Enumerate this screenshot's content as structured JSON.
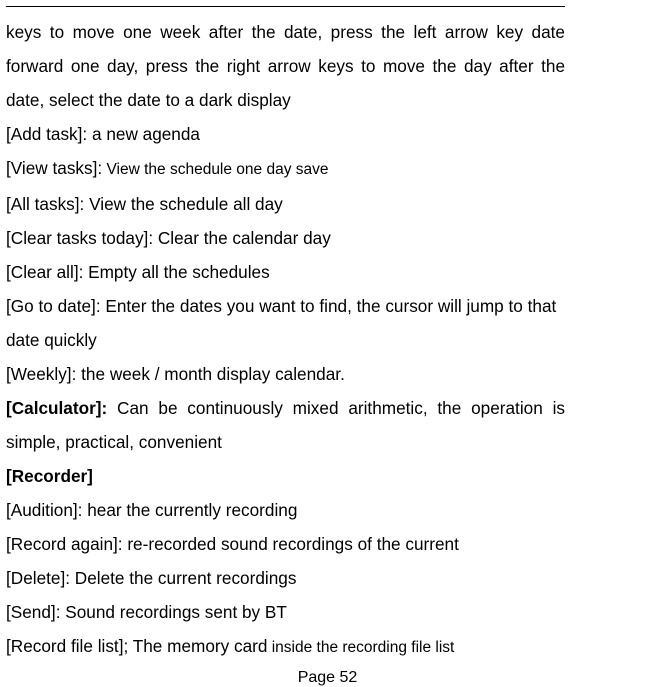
{
  "rule_present": true,
  "intro": "keys to move one week after the date, press the left arrow key date forward one day, press the right arrow keys to move the day after the date, select the date to a dark display",
  "items": [
    {
      "label": "[Add task]:",
      "text": " a new agenda"
    },
    {
      "label": "[View tasks]:",
      "text_small": " View the schedule one day save"
    },
    {
      "label": "[All tasks]:",
      "text": " View the schedule all day"
    },
    {
      "label": "[Clear tasks today]:",
      "text": " Clear the calendar day"
    },
    {
      "label": "[Clear all]:",
      "text": " Empty all the schedules"
    },
    {
      "label": "[Go to date]:",
      "text": " Enter the dates you want to find, the cursor will jump to that date quickly"
    },
    {
      "label": "[Weekly]:",
      "text": " the week / month display calendar."
    }
  ],
  "calculator": {
    "label": "[Calculator]:",
    "text": " Can be continuously mixed arithmetic, the operation is simple, practical, convenient"
  },
  "recorder_heading": "[Recorder]",
  "recorder_items": [
    {
      "label": "[Audition]:",
      "text": " hear the currently recording"
    },
    {
      "label": "[Record again]:",
      "text": " re-recorded sound recordings of the current"
    },
    {
      "label": "[Delete]:",
      "text": " Delete the current recordings"
    },
    {
      "label": "[Send]:",
      "text": " Sound recordings sent by BT"
    }
  ],
  "record_file_list": {
    "label": "[Record file list]; ",
    "text": "The memory card",
    "text_small": " inside the recording file list"
  },
  "page_number": "Page 52"
}
